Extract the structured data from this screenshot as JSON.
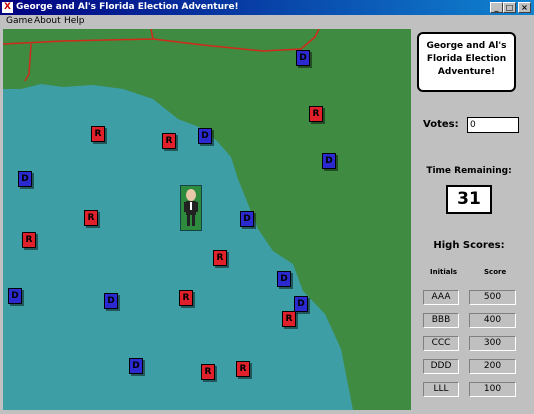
{
  "window": {
    "title": "George and Al's Florida Election Adventure!",
    "app_icon": "X"
  },
  "menu": [
    "Game",
    "About",
    "Help"
  ],
  "panel": {
    "logo_lines": [
      "George and Al's",
      "Florida Election",
      "Adventure!"
    ],
    "votes_label": "Votes:",
    "votes_value": "0",
    "time_label": "Time Remaining:",
    "time_value": "31",
    "high_scores_title": "High Scores:",
    "col_initials": "Initials",
    "col_score": "Score",
    "scores": [
      {
        "initials": "AAA",
        "score": "500"
      },
      {
        "initials": "BBB",
        "score": "400"
      },
      {
        "initials": "CCC",
        "score": "300"
      },
      {
        "initials": "DDD",
        "score": "200"
      },
      {
        "initials": "LLL",
        "score": "100"
      }
    ]
  },
  "ballots": [
    {
      "party": "D",
      "label": "D"
    },
    {
      "party": "R",
      "label": "R"
    },
    {
      "party": "R",
      "label": "R"
    },
    {
      "party": "D",
      "label": "D"
    },
    {
      "party": "R",
      "label": "R"
    },
    {
      "party": "D",
      "label": "D"
    },
    {
      "party": "D",
      "label": "D"
    },
    {
      "party": "R",
      "label": "R"
    },
    {
      "party": "D",
      "label": "D"
    },
    {
      "party": "R",
      "label": "R"
    },
    {
      "party": "R",
      "label": "R"
    },
    {
      "party": "D",
      "label": "D"
    },
    {
      "party": "D",
      "label": "D"
    },
    {
      "party": "D",
      "label": "D"
    },
    {
      "party": "R",
      "label": "R"
    },
    {
      "party": "D",
      "label": "D"
    },
    {
      "party": "R",
      "label": "R"
    },
    {
      "party": "D",
      "label": "D"
    },
    {
      "party": "R",
      "label": "R"
    },
    {
      "party": "R",
      "label": "R"
    }
  ],
  "colors": {
    "water": "#3d9ea6",
    "land": "#3f8b42",
    "republican": "#e0202a",
    "democrat": "#2a2ad0",
    "border": "#d12a1a"
  }
}
